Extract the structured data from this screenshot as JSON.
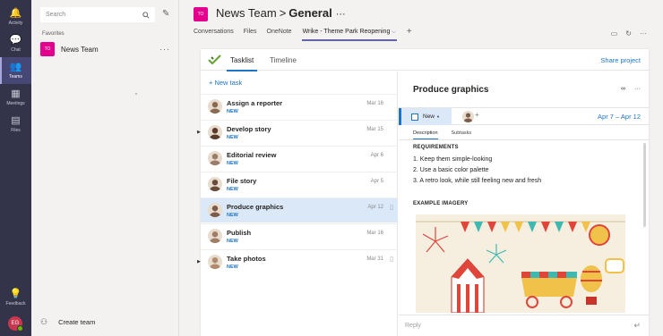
{
  "rail": {
    "items": [
      {
        "label": "Activity",
        "icon": "bell-icon",
        "glyph": "🔔"
      },
      {
        "label": "Chat",
        "icon": "chat-icon",
        "glyph": "💬"
      },
      {
        "label": "Teams",
        "icon": "teams-icon",
        "glyph": "👥"
      },
      {
        "label": "Meetings",
        "icon": "calendar-icon",
        "glyph": "▦"
      },
      {
        "label": "Files",
        "icon": "files-icon",
        "glyph": "▤"
      }
    ],
    "feedback": {
      "label": "Feedback",
      "icon": "lightbulb-icon",
      "glyph": "💡"
    },
    "me_initials": "EG"
  },
  "panel": {
    "search_placeholder": "Search",
    "favorites_label": "Favorites",
    "team": {
      "initials": "TO",
      "name": "News Team",
      "more": "···"
    },
    "create_team": "Create team"
  },
  "header": {
    "team_initials": "TO",
    "team_name": "News Team",
    "separator": ">",
    "channel": "General",
    "more": "···",
    "tabs": [
      "Conversations",
      "Files",
      "OneNote"
    ],
    "active_tab": "Wrike - Theme Park Reopening",
    "add_tab": "+"
  },
  "wrike": {
    "tabs": {
      "tasklist": "Tasklist",
      "timeline": "Timeline"
    },
    "share": "Share project",
    "new_task": "+ New task",
    "tasks": [
      {
        "title": "Assign a reporter",
        "status": "NEW",
        "date": "Mar 16",
        "caret": false,
        "clip": false,
        "selected": false,
        "avatar": "#8a6a52"
      },
      {
        "title": "Develop story",
        "status": "NEW",
        "date": "Mar 15",
        "caret": true,
        "clip": false,
        "selected": false,
        "avatar": "#5b3a2c"
      },
      {
        "title": "Editorial review",
        "status": "NEW",
        "date": "Apr 6",
        "caret": false,
        "clip": false,
        "selected": false,
        "avatar": "#9b7c66"
      },
      {
        "title": "File story",
        "status": "NEW",
        "date": "Apr 5",
        "caret": false,
        "clip": false,
        "selected": false,
        "avatar": "#6a4a3a"
      },
      {
        "title": "Produce graphics",
        "status": "NEW",
        "date": "Apr 12",
        "caret": false,
        "clip": true,
        "selected": true,
        "avatar": "#7c5c48"
      },
      {
        "title": "Publish",
        "status": "NEW",
        "date": "Mar 16",
        "caret": false,
        "clip": false,
        "selected": false,
        "avatar": "#a07e66"
      },
      {
        "title": "Take photos",
        "status": "NEW",
        "date": "Mar 31",
        "caret": true,
        "clip": true,
        "selected": false,
        "avatar": "#b08a6c"
      }
    ],
    "detail": {
      "title": "Produce graphics",
      "status": "New",
      "dates": "Apr 7 – Apr 12",
      "subtabs": [
        "Description",
        "Subtasks"
      ],
      "requirements_heading": "REQUIREMENTS",
      "requirements": [
        "1. Keep them simple-looking",
        "2. Use a basic color palette",
        "3. A retro look, while still feeling new and fresh"
      ],
      "example_heading": "EXAMPLE IMAGERY",
      "reply_placeholder": "Reply"
    }
  },
  "colors": {
    "accent": "#6264a7",
    "wrike_blue": "#1d74c7",
    "team_tile": "#e3008c",
    "rail": "#33344a"
  }
}
